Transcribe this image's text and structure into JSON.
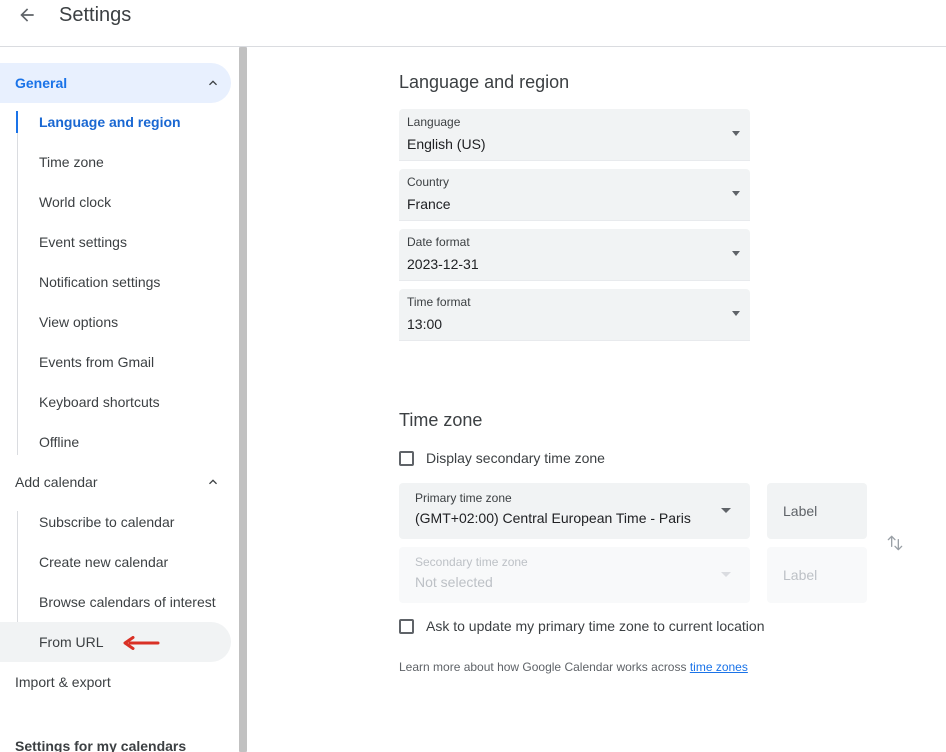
{
  "header": {
    "title": "Settings",
    "back_icon": "arrow-back-icon"
  },
  "sidebar": {
    "general": {
      "label": "General",
      "items": [
        {
          "label": "Language and region"
        },
        {
          "label": "Time zone"
        },
        {
          "label": "World clock"
        },
        {
          "label": "Event settings"
        },
        {
          "label": "Notification settings"
        },
        {
          "label": "View options"
        },
        {
          "label": "Events from Gmail"
        },
        {
          "label": "Keyboard shortcuts"
        },
        {
          "label": "Offline"
        }
      ]
    },
    "add_calendar": {
      "label": "Add calendar",
      "items": [
        {
          "label": "Subscribe to calendar"
        },
        {
          "label": "Create new calendar"
        },
        {
          "label": "Browse calendars of interest"
        },
        {
          "label": "From URL"
        }
      ]
    },
    "import_export": "Import & export",
    "settings_for_my_calendars": "Settings for my calendars"
  },
  "language_region": {
    "heading": "Language and region",
    "fields": [
      {
        "label": "Language",
        "value": "English (US)"
      },
      {
        "label": "Country",
        "value": "France"
      },
      {
        "label": "Date format",
        "value": "2023-12-31"
      },
      {
        "label": "Time format",
        "value": "13:00"
      }
    ]
  },
  "time_zone": {
    "heading": "Time zone",
    "display_secondary": "Display secondary time zone",
    "primary": {
      "label": "Primary time zone",
      "value": "(GMT+02:00) Central European Time - Paris"
    },
    "secondary": {
      "label": "Secondary time zone",
      "value": "Not selected"
    },
    "label_placeholder": "Label",
    "ask_update": "Ask to update my primary time zone to current location",
    "learn_more_text": "Learn more about how Google Calendar works across ",
    "learn_more_link": "time zones"
  },
  "colors": {
    "accent": "#1a73e8",
    "annotation_arrow": "#d93025"
  }
}
